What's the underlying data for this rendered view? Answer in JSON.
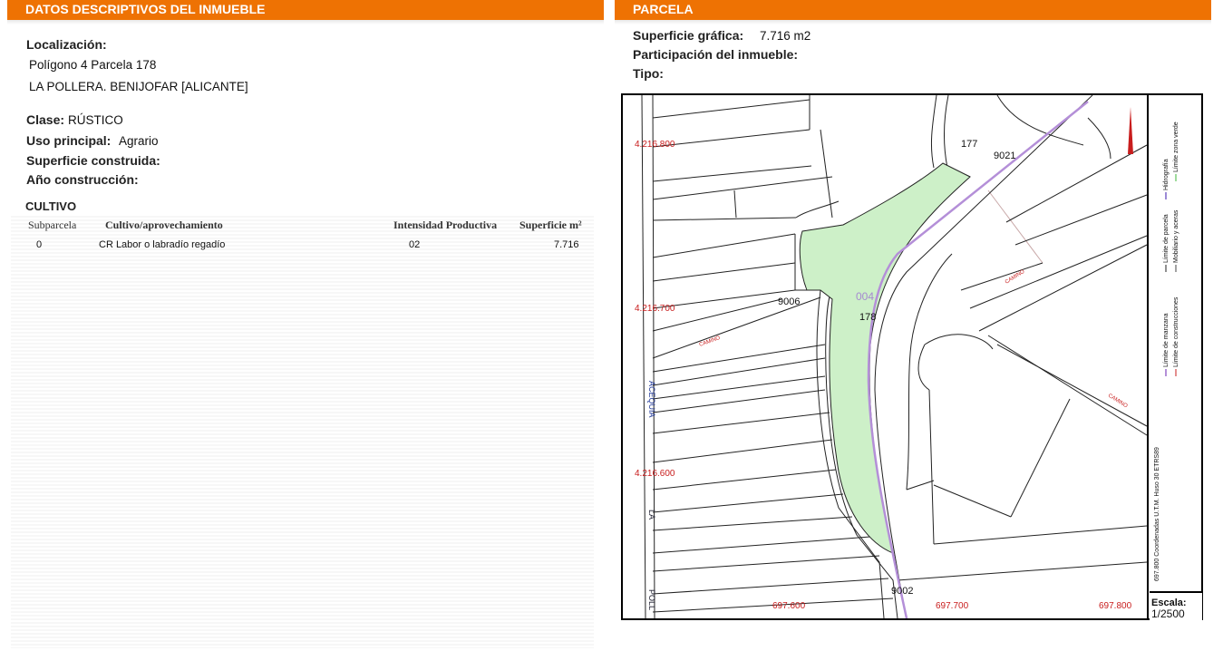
{
  "left_panel": {
    "header": "DATOS DESCRIPTIVOS DEL INMUEBLE",
    "localizacion_label": "Localización:",
    "localizacion_line1": "Polígono 4 Parcela 178",
    "localizacion_line2": "LA POLLERA. BENIJOFAR [ALICANTE]",
    "clase_label": "Clase:",
    "clase_value": "RÚSTICO",
    "uso_label": "Uso principal:",
    "uso_value": "Agrario",
    "superficie_construida_label": "Superficie construida:",
    "anio_label": "Año construcción:",
    "cultivo_title": "CULTIVO",
    "table": {
      "headers": [
        "Subparcela",
        "Cultivo/aprovechamiento",
        "Intensidad Productiva",
        "Superficie m²"
      ],
      "rows": [
        {
          "subparcela": "0",
          "cultivo": "CR Labor o labradío regadío",
          "intensidad": "02",
          "superficie": "7.716"
        }
      ]
    }
  },
  "right_panel": {
    "header": "PARCELA",
    "superficie_grafica_label": "Superficie gráfica:",
    "superficie_grafica_value": "7.716 m2",
    "participacion_label": "Participación del inmueble:",
    "tipo_label": "Tipo:"
  },
  "map": {
    "coords_y": [
      "4.216.800",
      "4.216.700",
      "4.216.600"
    ],
    "coords_x": [
      "697.600",
      "697.700",
      "697.800"
    ],
    "parcel_numbers": [
      "177",
      "9021",
      "9006",
      "178",
      "9002"
    ],
    "parcel_code": "004",
    "road_labels": [
      "CAMINO",
      "CAMINO",
      "CAMINO"
    ],
    "acequia_label": "ACEQUIA",
    "side_labels": [
      "LA",
      "POLL"
    ],
    "legend": [
      "Límite de manzana",
      "Límite de parcela",
      "Hidrografía",
      "Límite zona verde",
      "Límite de construcciones",
      "Mobiliario y aceras"
    ],
    "projection": "697.800 Coordenadas U.T.M. Huso 30 ETRS89",
    "escala_label": "Escala:",
    "escala_value": "1/2500",
    "colors": {
      "parcel_fill": "#cdf0c8",
      "hydro": "#b48fd8",
      "coords": "#c81d1d"
    }
  }
}
